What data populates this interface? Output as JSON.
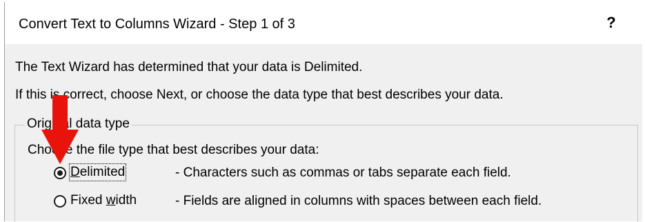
{
  "dialog": {
    "title": "Convert Text to Columns Wizard - Step 1 of 3",
    "help_label": "?"
  },
  "intro": {
    "line1": "The Text Wizard has determined that your data is Delimited.",
    "line2": "If this is correct, choose Next, or choose the data type that best describes your data."
  },
  "group": {
    "legend": "Original data type",
    "prompt": "Choose the file type that best describes your data:",
    "options": [
      {
        "label_prefix": "D",
        "label_rest": "elimited",
        "description": "- Characters such as commas or tabs separate each field.",
        "selected": true
      },
      {
        "label_prefix": "Fixed ",
        "label_underlined": "w",
        "label_rest": "idth",
        "description": "- Fields are aligned in columns with spaces between each field.",
        "selected": false
      }
    ]
  },
  "annotation": {
    "arrow_color": "#e8140c"
  }
}
